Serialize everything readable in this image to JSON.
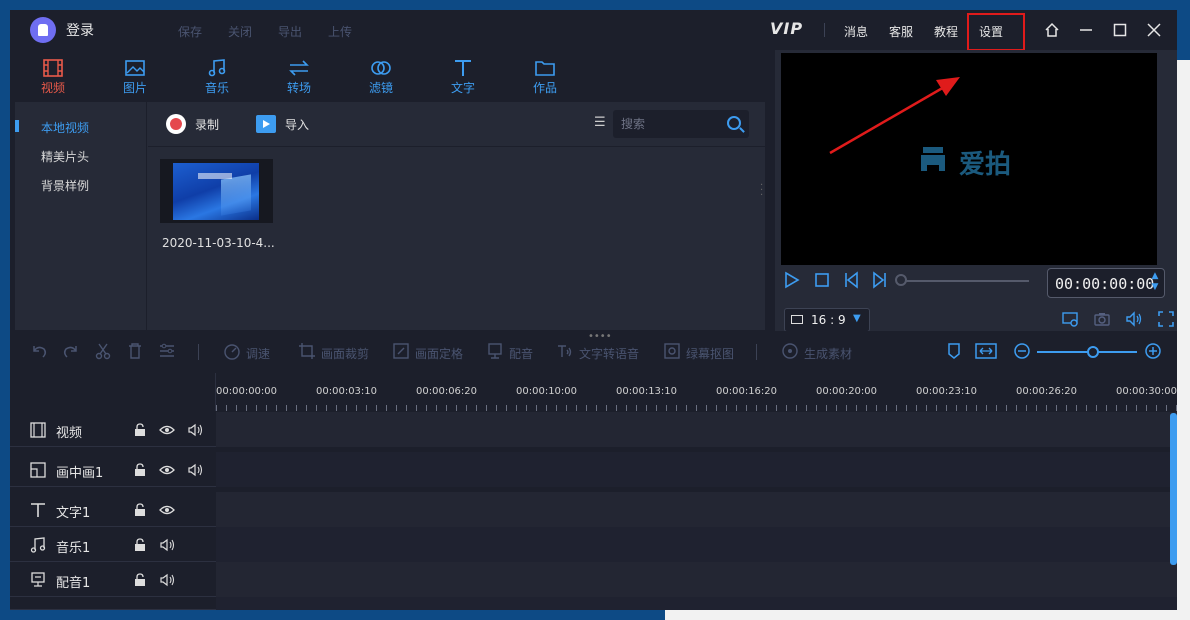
{
  "titlebar": {
    "login": "登录",
    "menu": [
      "保存",
      "关闭",
      "导出",
      "上传"
    ],
    "vip": "VIP",
    "right_menu": [
      "消息",
      "客服",
      "教程",
      "设置"
    ],
    "settings_highlight_color": "#e01b1b"
  },
  "tabs": [
    {
      "label": "视频",
      "icon": "film-icon",
      "active": true
    },
    {
      "label": "图片",
      "icon": "image-icon",
      "active": false
    },
    {
      "label": "音乐",
      "icon": "music-icon",
      "active": false
    },
    {
      "label": "转场",
      "icon": "transition-icon",
      "active": false
    },
    {
      "label": "滤镜",
      "icon": "filter-icon",
      "active": false
    },
    {
      "label": "文字",
      "icon": "text-icon",
      "active": false
    },
    {
      "label": "作品",
      "icon": "folder-icon",
      "active": false
    }
  ],
  "sidebar": {
    "items": [
      "本地视频",
      "精美片头",
      "背景样例"
    ]
  },
  "media_toolbar": {
    "record": "录制",
    "import": "导入",
    "search_placeholder": "搜索"
  },
  "media": {
    "file_name": "2020-11-03-10-4..."
  },
  "preview": {
    "brand": "爱拍",
    "time": "00:00:00:00",
    "ratio": "16 : 9"
  },
  "timeline_toolbar": {
    "items": [
      "调速",
      "画面裁剪",
      "画面定格",
      "配音",
      "文字转语音",
      "绿幕抠图",
      "生成素材"
    ]
  },
  "ruler": {
    "labels": [
      "00:00:00:00",
      "00:00:03:10",
      "00:00:06:20",
      "00:00:10:00",
      "00:00:13:10",
      "00:00:16:20",
      "00:00:20:00",
      "00:00:23:10",
      "00:00:26:20",
      "00:00:30:00"
    ]
  },
  "tracks": [
    {
      "name": "视频",
      "icon": "film-icon",
      "controls": [
        "lock-icon",
        "eye-icon",
        "speaker-icon"
      ]
    },
    {
      "name": "画中画1",
      "icon": "pip-icon",
      "controls": [
        "lock-icon",
        "eye-icon",
        "speaker-icon"
      ]
    },
    {
      "name": "文字1",
      "icon": "text-icon",
      "controls": [
        "lock-icon",
        "eye-icon"
      ]
    },
    {
      "name": "音乐1",
      "icon": "music-icon",
      "controls": [
        "lock-icon",
        "speaker-icon"
      ]
    },
    {
      "name": "配音1",
      "icon": "mic-icon",
      "controls": [
        "lock-icon",
        "speaker-icon"
      ]
    }
  ],
  "colors": {
    "accent": "#3d9cf0",
    "active_tab": "#e95a4a",
    "arrow": "#e01b1b"
  }
}
